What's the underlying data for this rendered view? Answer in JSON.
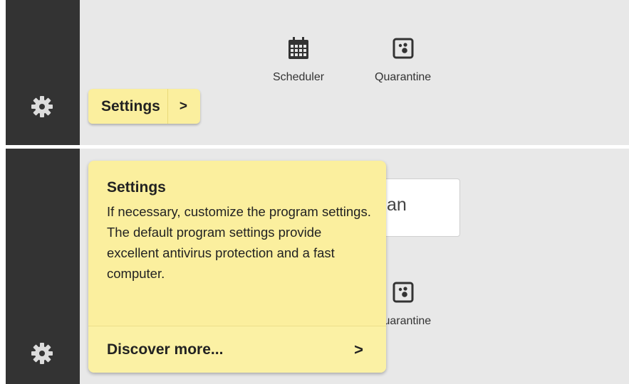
{
  "top": {
    "toolbar": [
      {
        "label": "Scheduler",
        "icon": "calendar-icon"
      },
      {
        "label": "Quarantine",
        "icon": "quarantine-icon"
      }
    ],
    "tooltip": {
      "label": "Settings",
      "chevron": ">"
    }
  },
  "bottom": {
    "scan_partial_text": "an",
    "quarantine_partial_label": "Quarantine",
    "popover": {
      "title": "Settings",
      "description": "If necessary, customize the program settings. The default program settings provide excellent antivirus protection and a fast computer.",
      "link_label": "Discover more...",
      "link_chevron": ">"
    }
  },
  "icons": {
    "settings": "gear-icon"
  },
  "colors": {
    "sidebar": "#333333",
    "main_background": "#e8e8e8",
    "tooltip_background": "#fbef9e",
    "icon_dark": "#333333"
  }
}
